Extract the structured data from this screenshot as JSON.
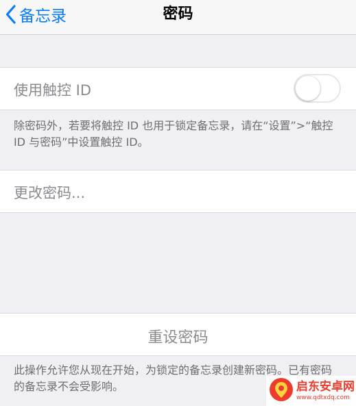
{
  "nav": {
    "back_label": "备忘录",
    "title": "密码"
  },
  "touch_id": {
    "label": "使用触控 ID",
    "enabled": false,
    "footer": "除密码外，若要将触控 ID 也用于锁定备忘录，请在“设置”>“触控 ID 与密码”中设置触控 ID。"
  },
  "change_password": {
    "label": "更改密码..."
  },
  "reset_password": {
    "label": "重设密码",
    "footer": "此操作允许您从现在开始，为锁定的备忘录创建新密码。已有密码的备忘录不会受影响。"
  },
  "watermark": {
    "title": "启东安卓网",
    "url": "www.qdtxdq.com"
  },
  "colors": {
    "accent": "#0a7aff",
    "background": "#efeff4",
    "watermark": "#ef3b2d"
  },
  "icons": {
    "back": "chevron-left-icon",
    "watermark_logo": "watermark-logo-icon"
  }
}
